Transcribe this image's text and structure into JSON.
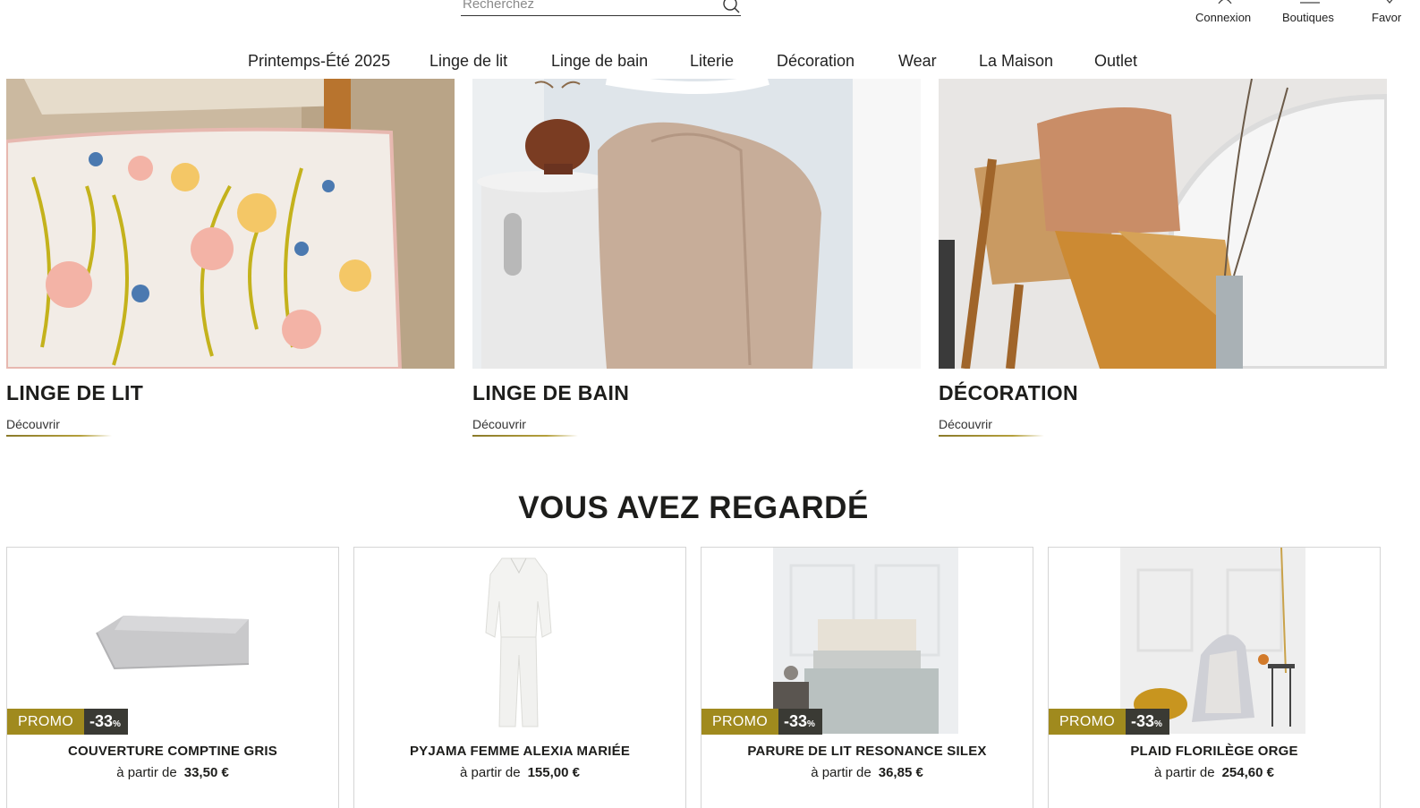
{
  "header": {
    "search_placeholder": "Recherchez",
    "connexion_label": "Connexion",
    "boutiques_label": "Boutiques",
    "favoris_label": "Favor"
  },
  "nav": {
    "items": [
      "Printemps-Été 2025",
      "Linge de lit",
      "Linge de bain",
      "Literie",
      "Décoration",
      "Wear",
      "La Maison",
      "Outlet"
    ]
  },
  "categories": [
    {
      "title": "LINGE DE LIT",
      "link": "Découvrir"
    },
    {
      "title": "LINGE DE BAIN",
      "link": "Découvrir"
    },
    {
      "title": "DÉCORATION",
      "link": "Découvrir"
    }
  ],
  "recently_viewed": {
    "title": "VOUS AVEZ REGARDÉ",
    "products": [
      {
        "name": "COUVERTURE COMPTINE GRIS",
        "price_prefix": "à partir de",
        "price": "33,50 €",
        "promo": "PROMO",
        "discount": "-33",
        "discount_unit": "%"
      },
      {
        "name": "PYJAMA FEMME ALEXIA MARIÉE",
        "price_prefix": "à partir de",
        "price": "155,00 €"
      },
      {
        "name": "PARURE DE LIT RESONANCE SILEX",
        "price_prefix": "à partir de",
        "price": "36,85 €",
        "promo": "PROMO",
        "discount": "-33",
        "discount_unit": "%"
      },
      {
        "name": "PLAID FLORILÈGE ORGE",
        "price_prefix": "à partir de",
        "price": "254,60 €",
        "promo": "PROMO",
        "discount": "-33",
        "discount_unit": "%"
      }
    ]
  },
  "colors": {
    "accent_gold": "#a08a1e",
    "discount_dark": "#3a3a34",
    "text": "#1d1d1b"
  }
}
